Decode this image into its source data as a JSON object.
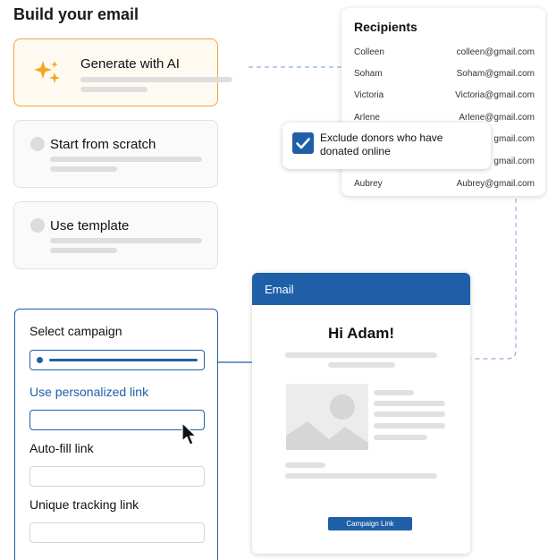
{
  "page": {
    "title": "Build your email"
  },
  "options": [
    {
      "label": "Generate with AI",
      "state": "active"
    },
    {
      "label": "Start from scratch",
      "state": "inactive"
    },
    {
      "label": "Use template",
      "state": "inactive"
    }
  ],
  "recipients": {
    "title": "Recipients",
    "rows": [
      {
        "name": "Colleen",
        "email": "colleen@gmail.com"
      },
      {
        "name": "Soham",
        "email": "Soham@gmail.com"
      },
      {
        "name": "Victoria",
        "email": "Victoria@gmail.com"
      },
      {
        "name": "Arlene",
        "email": "Arlene@gmail.com"
      },
      {
        "name": "",
        "email": "gmail.com"
      },
      {
        "name": "",
        "email": "gmail.com"
      },
      {
        "name": "Aubrey",
        "email": "Aubrey@gmail.com"
      }
    ]
  },
  "exclude": {
    "label": "Exclude donors who have donated online",
    "checked": true
  },
  "campaign": {
    "select_label": "Select campaign",
    "personalized_label": "Use personalized link",
    "autofill_label": "Auto-fill link",
    "tracking_label": "Unique tracking link"
  },
  "email": {
    "header": "Email",
    "greeting": "Hi Adam!",
    "cta": "Campaign Link"
  },
  "colors": {
    "primary": "#1f5fa8",
    "accent": "#f2a23c",
    "sparkle": "#f5a623"
  }
}
